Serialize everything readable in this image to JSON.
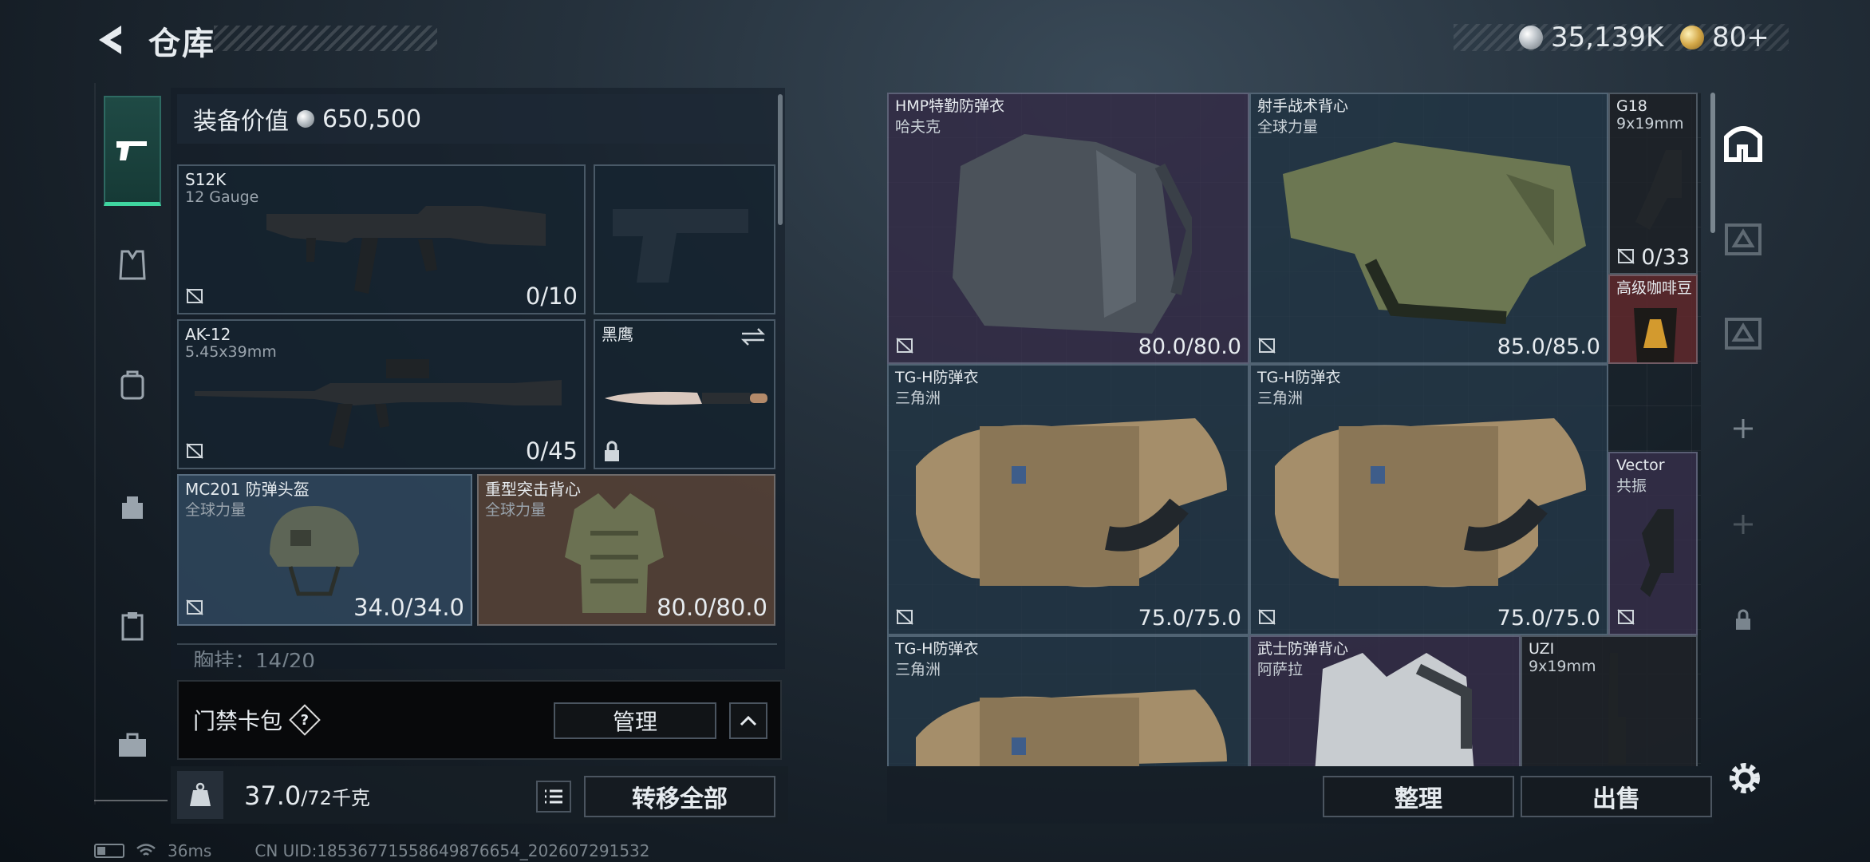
{
  "header": {
    "title": "仓库",
    "silver_amount": "35,139K",
    "gold_amount": "80+"
  },
  "equipment": {
    "value_label": "装备价值",
    "value_amount": "650,500",
    "slots": [
      {
        "name": "S12K",
        "sub": "12 Gauge",
        "count": "0/10"
      },
      {
        "name": "AK-12",
        "sub": "5.45x39mm",
        "count": "0/45"
      },
      {
        "name": "黑鹰",
        "sub": "",
        "count": ""
      },
      {
        "name": "MC201 防弹头盔",
        "sub": "全球力量",
        "count": "34.0/34.0"
      },
      {
        "name": "重型突击背心",
        "sub": "全球力量",
        "count": "80.0/80.0"
      }
    ],
    "chest_peek": "胸挂：14/20"
  },
  "keycard": {
    "label": "门禁卡包",
    "help": "?",
    "manage_label": "管理"
  },
  "weight": {
    "current": "37.0",
    "max": "/72千克",
    "transfer_label": "转移全部"
  },
  "status_bar": {
    "ping": "36ms",
    "uid": "CN UID:18536771558649876654_202607291532"
  },
  "storage": {
    "items": [
      {
        "name": "HMP特勤防弹衣",
        "sub": "哈夫克",
        "count": "80.0/80.0"
      },
      {
        "name": "射手战术背心",
        "sub": "全球力量",
        "count": "85.0/85.0"
      },
      {
        "name": "G18",
        "sub": "9x19mm",
        "count": "0/33"
      },
      {
        "name": "高级咖啡豆",
        "sub": "",
        "count": ""
      },
      {
        "name": "TG-H防弹衣",
        "sub": "三角洲",
        "count": "75.0/75.0"
      },
      {
        "name": "TG-H防弹衣",
        "sub": "三角洲",
        "count": "75.0/75.0"
      },
      {
        "name": "Vector",
        "sub": "共振",
        "count": ""
      },
      {
        "name": "TG-H防弹衣",
        "sub": "三角洲",
        "count": ""
      },
      {
        "name": "武士防弹背心",
        "sub": "阿萨拉",
        "count": ""
      },
      {
        "name": "UZI",
        "sub": "9x19mm",
        "count": ""
      }
    ],
    "sort_label": "整理",
    "sell_label": "出售"
  },
  "colors": {
    "accent": "#3fd6a0",
    "slot_blue": "#344e66",
    "slot_brown": "#5e4638",
    "slot_purple": "#3a304e",
    "slot_red": "#60282c"
  }
}
